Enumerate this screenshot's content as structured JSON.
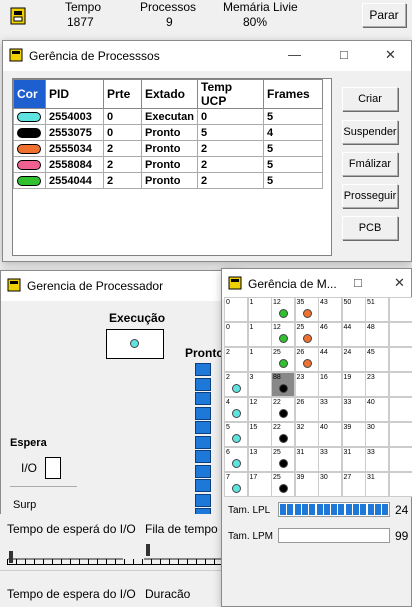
{
  "toolbar": {
    "time_label": "Tempo",
    "time_value": "1877",
    "proc_label": "Processos",
    "proc_value": "9",
    "mem_label": "Memária Livie",
    "mem_value": "80%",
    "stop_label": "Parar"
  },
  "processes_window": {
    "title": "Gerência de Processsos",
    "columns": [
      "Cor",
      "PID",
      "Prte",
      "Extado",
      "Temp UCP",
      "Frames"
    ],
    "rows": [
      {
        "color": "#5fe3e0",
        "pid": "2554003",
        "prio": "0",
        "state": "Executan",
        "cpu": "0",
        "frames": "5"
      },
      {
        "color": "#000000",
        "pid": "2553075",
        "prio": "0",
        "state": "Pronto",
        "cpu": "5",
        "frames": "4"
      },
      {
        "color": "#f07030",
        "pid": "2555034",
        "prio": "2",
        "state": "Pronto",
        "cpu": "2",
        "frames": "5"
      },
      {
        "color": "#f06090",
        "pid": "2558084",
        "prio": "2",
        "state": "Pronto",
        "cpu": "2",
        "frames": "5"
      },
      {
        "color": "#30c030",
        "pid": "2554044",
        "prio": "2",
        "state": "Pronto",
        "cpu": "2",
        "frames": "5"
      }
    ],
    "buttons": [
      "Criar",
      "Suspender",
      "Fmálizar",
      "Prosseguir",
      "PCB"
    ]
  },
  "processor_window": {
    "title": "Gerencia de Processador",
    "exec_label": "Execução",
    "ready_label": "Pronto",
    "wait_label": "Espera",
    "io_label": "I/O",
    "surp_label": "Surp",
    "io_wait_label": "Tempo de esperá do I/O",
    "queue_label": "Fila de tempo",
    "io_wait2_label": "Tempo de espera do I/O",
    "duration_label": "Duracão"
  },
  "memory_window": {
    "title": "Gerência de M...",
    "cells": [
      [
        "0",
        "1",
        "12",
        "35",
        "43",
        "50",
        "51",
        ""
      ],
      [
        "0",
        "1",
        "12",
        "25",
        "46",
        "44",
        "48",
        ""
      ],
      [
        "2",
        "1",
        "25",
        "26",
        "44",
        "24",
        "45",
        ""
      ],
      [
        "2",
        "3",
        "88",
        "23",
        "16",
        "19",
        "23",
        ""
      ],
      [
        "4",
        "12",
        "22",
        "26",
        "33",
        "33",
        "40",
        ""
      ],
      [
        "5",
        "15",
        "22",
        "32",
        "40",
        "39",
        "30",
        ""
      ],
      [
        "6",
        "13",
        "25",
        "31",
        "33",
        "31",
        "33",
        ""
      ],
      [
        "7",
        "17",
        "25",
        "39",
        "30",
        "27",
        "31",
        ""
      ]
    ],
    "lpl_label": "Tam. LPL",
    "lpl_value": "24",
    "lpm_label": "Tam. LPM",
    "lpm_value": "99"
  },
  "colors": {
    "cyan": "#5fe3e0",
    "black": "#000000",
    "orange": "#f07030",
    "pink": "#f06090",
    "green": "#30c030",
    "blue_block": "#1e78d8"
  }
}
